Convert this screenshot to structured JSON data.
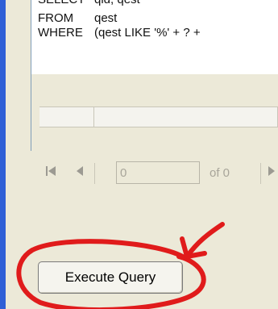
{
  "query": {
    "lines": [
      {
        "keyword": "SELECT",
        "text": "qid, qest"
      },
      {
        "keyword": "FROM",
        "text": "qest"
      },
      {
        "keyword": "WHERE",
        "text": "(qest LIKE '%' + ? +"
      }
    ]
  },
  "navigator": {
    "first_icon": "first-record-icon",
    "prev_icon": "previous-record-icon",
    "next_icon": "next-record-icon",
    "position_value": "0",
    "of_text": "of 0"
  },
  "actions": {
    "execute_label": "Execute Query"
  },
  "annotation": {
    "color": "#e01b1b"
  }
}
